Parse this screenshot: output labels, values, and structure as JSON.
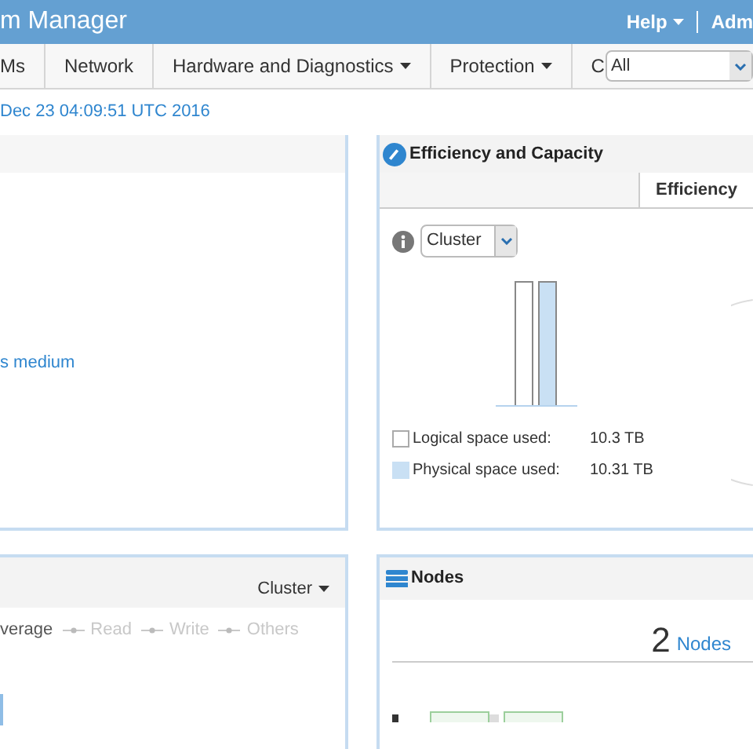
{
  "header": {
    "title": "m Manager",
    "help": "Help",
    "account": "Adm"
  },
  "nav": {
    "tabs": [
      {
        "label": "Ms",
        "has_menu": false
      },
      {
        "label": "Network",
        "has_menu": false
      },
      {
        "label": "Hardware and Diagnostics",
        "has_menu": true
      },
      {
        "label": "Protection",
        "has_menu": true
      },
      {
        "label": "C",
        "has_menu": false
      }
    ],
    "filter": {
      "value": "All"
    }
  },
  "timestamp": "Dec 23 04:09:51 UTC 2016",
  "status_panel": {
    "link": "s medium"
  },
  "efficiency": {
    "title": "Efficiency and Capacity",
    "tab": {
      "label": "Efficiency",
      "selected": true
    },
    "scope": "Cluster",
    "legend": [
      {
        "kind": "logical",
        "label": "Logical space used:",
        "value": "10.3 TB"
      },
      {
        "kind": "physical",
        "label": "Physical space used:",
        "value": "10.31 TB"
      }
    ]
  },
  "performance": {
    "scope": "Cluster",
    "legend": [
      {
        "label": "verage",
        "active": true
      },
      {
        "label": "Read",
        "active": false
      },
      {
        "label": "Write",
        "active": false
      },
      {
        "label": "Others",
        "active": false
      }
    ]
  },
  "nodes": {
    "title": "Nodes",
    "count": "2",
    "count_label": "Nodes"
  }
}
